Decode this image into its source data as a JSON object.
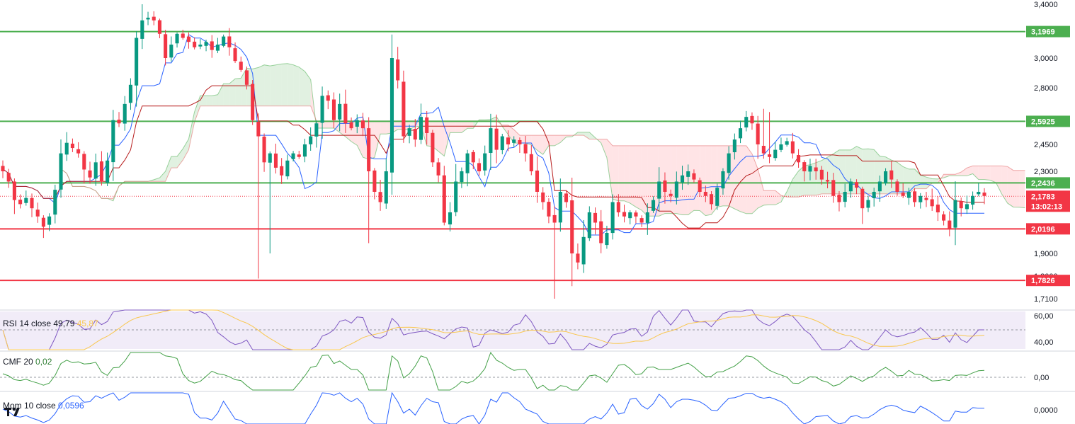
{
  "chart_data": {
    "type": "candlestick",
    "price_axis": {
      "ticks": [
        "3,4000",
        "3,0000",
        "2,8000",
        "2,4500",
        "2,3000",
        "1,9000",
        "1,8000",
        "1,7100"
      ],
      "tick_values": [
        3.4,
        3.0,
        2.8,
        2.45,
        2.3,
        1.9,
        1.8,
        1.71
      ]
    },
    "horizontal_levels": [
      {
        "value": 3.1969,
        "label": "3,1969",
        "color": "#4caf50"
      },
      {
        "value": 2.5925,
        "label": "2,5925",
        "color": "#4caf50"
      },
      {
        "value": 2.2436,
        "label": "2,2436",
        "color": "#4caf50"
      },
      {
        "value": 2.0196,
        "label": "2,0196",
        "color": "#f23645"
      },
      {
        "value": 1.7826,
        "label": "1,7826",
        "color": "#f23645"
      }
    ],
    "last_price": {
      "value": 2.1783,
      "label": "2,1783",
      "countdown": "13:02:13",
      "color": "#f23645"
    },
    "closes": [
      2.3,
      2.25,
      2.16,
      2.14,
      2.17,
      2.12,
      2.08,
      2.03,
      2.08,
      2.21,
      2.4,
      2.46,
      2.43,
      2.4,
      2.31,
      2.27,
      2.35,
      2.25,
      2.36,
      2.6,
      2.58,
      2.7,
      2.82,
      3.15,
      3.28,
      3.3,
      3.28,
      3.18,
      3.0,
      3.1,
      3.18,
      3.15,
      3.12,
      3.08,
      3.1,
      3.12,
      3.06,
      3.1,
      3.16,
      3.08,
      2.98,
      2.92,
      2.82,
      2.6,
      2.5,
      2.35,
      2.4,
      2.32,
      2.28,
      2.36,
      2.4,
      2.38,
      2.45,
      2.5,
      2.58,
      2.75,
      2.72,
      2.6,
      2.7,
      2.58,
      2.55,
      2.6,
      2.55,
      2.3,
      2.2,
      2.15,
      2.3,
      3.0,
      2.85,
      2.5,
      2.55,
      2.48,
      2.62,
      2.52,
      2.35,
      2.28,
      2.05,
      2.1,
      2.25,
      2.3,
      2.4,
      2.35,
      2.3,
      2.4,
      2.55,
      2.42,
      2.5,
      2.45,
      2.48,
      2.45,
      2.4,
      2.3,
      2.2,
      2.15,
      2.08,
      2.05,
      2.2,
      2.15,
      1.9,
      1.86,
      1.98,
      2.1,
      2.05,
      1.95,
      2.0,
      2.15,
      2.1,
      2.08,
      2.1,
      2.08,
      2.05,
      2.1,
      2.16,
      2.25,
      2.2,
      2.18,
      2.25,
      2.28,
      2.3,
      2.26,
      2.2,
      2.18,
      2.14,
      2.22,
      2.3,
      2.4,
      2.48,
      2.55,
      2.62,
      2.58,
      2.45,
      2.4,
      2.38,
      2.42,
      2.45,
      2.47,
      2.4,
      2.35,
      2.3,
      2.33,
      2.3,
      2.26,
      2.25,
      2.18,
      2.15,
      2.2,
      2.25,
      2.22,
      2.12,
      2.16,
      2.2,
      2.25,
      2.3,
      2.26,
      2.2,
      2.18,
      2.2,
      2.15,
      2.18,
      2.16,
      2.13,
      2.1,
      2.06,
      2.02,
      2.16,
      2.12,
      2.14,
      2.18,
      2.2,
      2.18
    ],
    "indicators": [
      {
        "name": "RSI",
        "label": "RSI 14 close",
        "values": [
          "49,79",
          "45,87"
        ],
        "value_colors": [
          "#131722",
          "#f9c74f"
        ],
        "ticks": [
          "60,00",
          "40,00"
        ],
        "line_color": "#7e57c2",
        "ma_color": "#f9c74f",
        "band_color": "#ede7f6"
      },
      {
        "name": "CMF",
        "label": "CMF 20",
        "values": [
          "0,02"
        ],
        "value_colors": [
          "#2e7d32"
        ],
        "ticks": [
          "0,00"
        ],
        "line_color": "#43a047"
      },
      {
        "name": "Mom",
        "label": "Mom 10 close",
        "values": [
          "0,0596"
        ],
        "value_colors": [
          "#2962ff"
        ],
        "ticks": [
          "0,0000"
        ],
        "line_color": "#2962ff"
      }
    ],
    "colors": {
      "up": "#089981",
      "down": "#f23645",
      "tenkan": "#2962ff",
      "kijun": "#b71c1c",
      "cloud_bull": "#c8e6c9",
      "cloud_bear": "#ffcdd2"
    }
  }
}
